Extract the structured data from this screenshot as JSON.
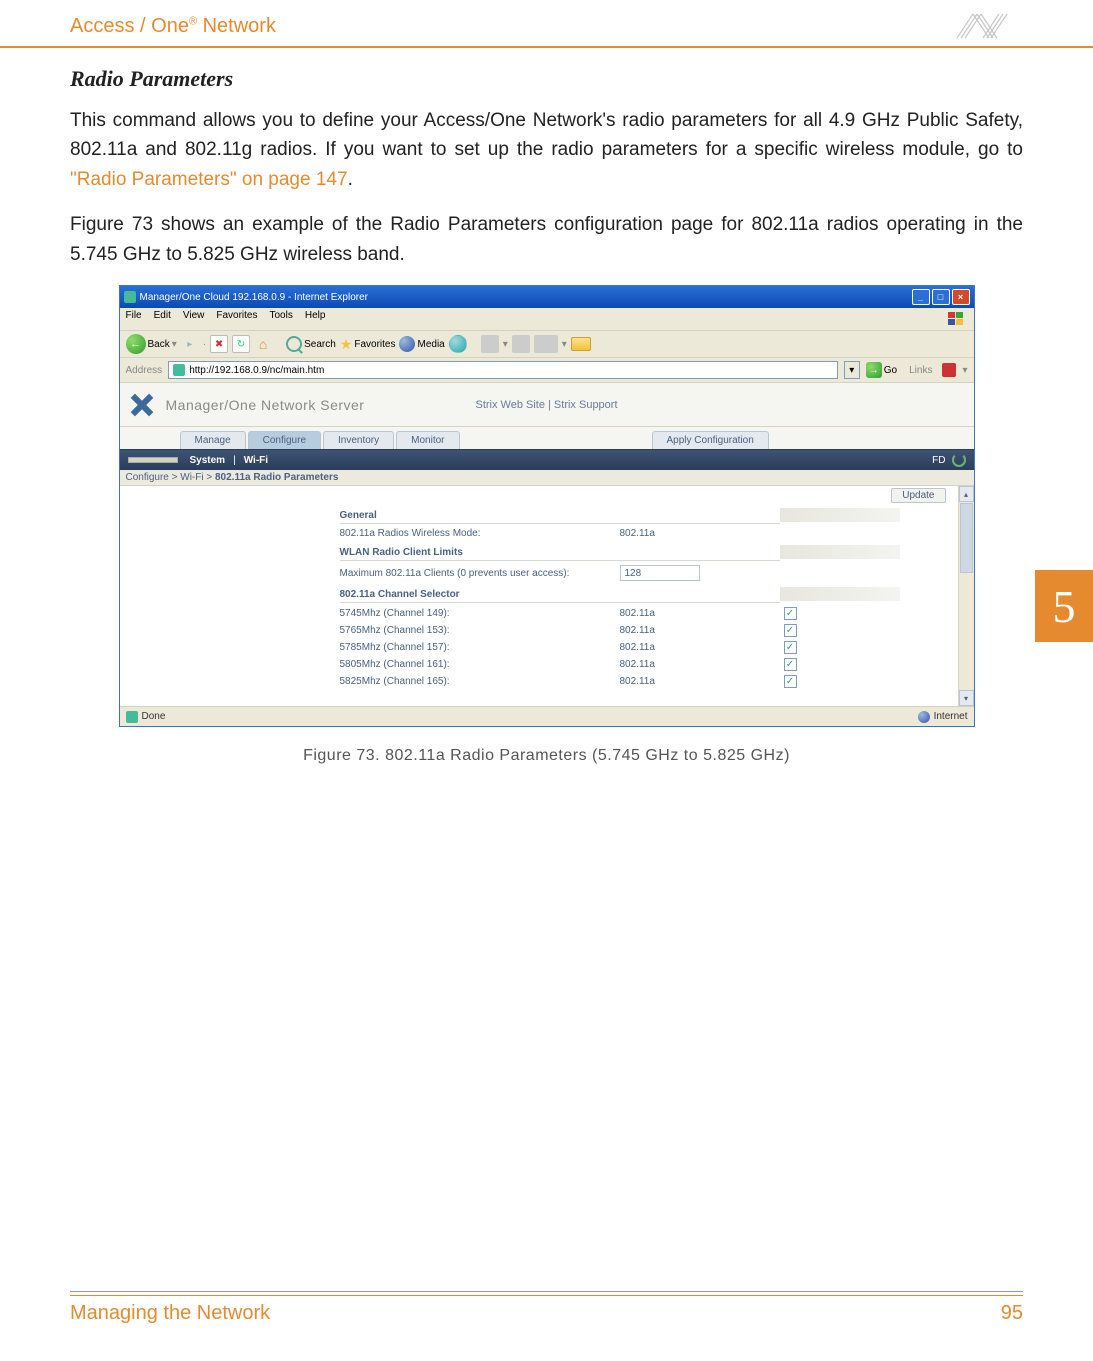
{
  "header": {
    "brand_pre": "Access / One",
    "brand_sup": "®",
    "brand_post": " Network"
  },
  "section_heading": "Radio Parameters",
  "para1_a": "This command allows you to define your Access/One Network's radio parameters for all 4.9 GHz Public Safety, 802.11a and 802.11g radios. If you want to set up the radio parameters for a specific wireless module, go to ",
  "para1_link": "\"Radio Parameters\" on page 147",
  "para1_b": ".",
  "para2": "Figure 73 shows an example of the Radio Parameters configuration page for 802.11a radios operating in the 5.745 GHz to 5.825 GHz wireless band.",
  "ie": {
    "title": "Manager/One Cloud 192.168.0.9 - Internet Explorer",
    "win_min": "_",
    "win_max": "□",
    "win_close": "×",
    "menu": {
      "file": "File",
      "edit": "Edit",
      "view": "View",
      "favorites": "Favorites",
      "tools": "Tools",
      "help": "Help"
    },
    "toolbar": {
      "back_arrow": "←",
      "back": "Back",
      "fwd": "▸",
      "stop": "✖",
      "refresh": "↻",
      "home": "⌂",
      "search": "Search",
      "favorites": "Favorites",
      "media": "Media",
      "dd": "▾"
    },
    "address": {
      "label": "Address",
      "url": "http://192.168.0.9/nc/main.htm",
      "dd": "▾",
      "go_arrow": "→",
      "go": "Go",
      "links": "Links",
      "links_dd": "▾"
    },
    "app": {
      "title": "Manager/One Network Server",
      "top_links": "Strix Web Site  |  Strix Support",
      "tabs": {
        "manage": "Manage",
        "configure": "Configure",
        "inventory": "Inventory",
        "monitor": "Monitor",
        "apply": "Apply Configuration"
      },
      "subbar": {
        "disabled": "",
        "system": "System",
        "pipe": "|",
        "wifi": "Wi-Fi",
        "fd": "FD"
      },
      "breadcrumb_pre": "Configure > Wi-Fi > ",
      "breadcrumb_bold": "802.11a Radio Parameters",
      "update": "Update",
      "general": {
        "head": "General",
        "row_label": "802.11a Radios Wireless Mode:",
        "row_val": "802.11a"
      },
      "wlan": {
        "head": "WLAN Radio Client Limits",
        "row_label": "Maximum 802.11a Clients (0 prevents user access):",
        "row_val": "128"
      },
      "channel": {
        "head": "802.11a Channel Selector",
        "rows": [
          {
            "label": "5745Mhz (Channel 149):",
            "val": "802.11a",
            "chk": "✓"
          },
          {
            "label": "5765Mhz (Channel 153):",
            "val": "802.11a",
            "chk": "✓"
          },
          {
            "label": "5785Mhz (Channel 157):",
            "val": "802.11a",
            "chk": "✓"
          },
          {
            "label": "5805Mhz (Channel 161):",
            "val": "802.11a",
            "chk": "✓"
          },
          {
            "label": "5825Mhz (Channel 165):",
            "val": "802.11a",
            "chk": "✓"
          }
        ]
      },
      "scroll": {
        "up": "▴",
        "down": "▾"
      }
    },
    "status": {
      "done": "Done",
      "zone": "Internet"
    }
  },
  "figure_caption": "Figure 73. 802.11a Radio Parameters (5.745 GHz to 5.825 GHz)",
  "side_tab": "5",
  "footer": {
    "left": "Managing the Network",
    "right": "95"
  }
}
